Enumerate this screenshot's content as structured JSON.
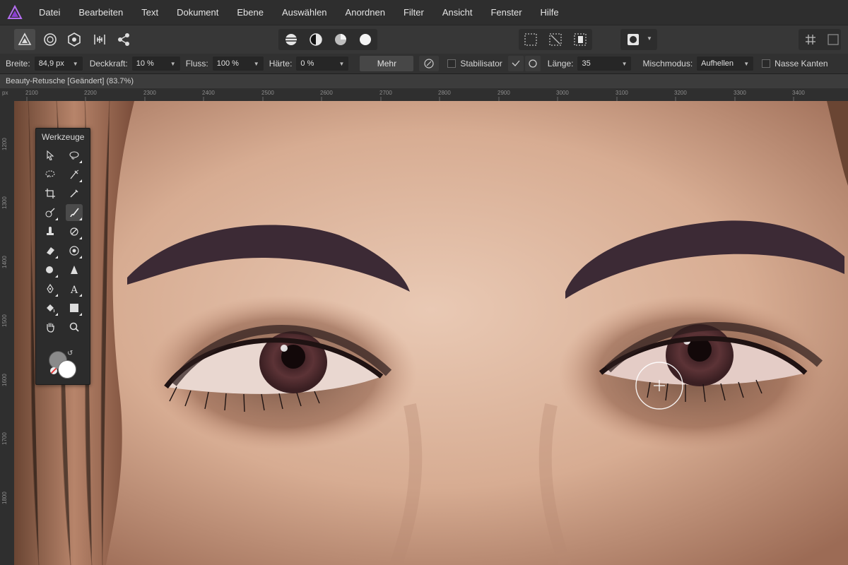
{
  "app": {
    "logo_icon": "affinity-photo-logo-icon",
    "accent": "#a25bd7"
  },
  "menu": [
    "Datei",
    "Bearbeiten",
    "Text",
    "Dokument",
    "Ebene",
    "Auswählen",
    "Anordnen",
    "Filter",
    "Ansicht",
    "Fenster",
    "Hilfe"
  ],
  "toolbar": {
    "personas": [
      "photo-persona-icon",
      "liquify-persona-icon",
      "develop-persona-icon",
      "tone-mapping-persona-icon",
      "export-persona-icon"
    ],
    "adjust": [
      "auto-levels-icon",
      "auto-contrast-icon",
      "auto-colors-icon",
      "auto-white-balance-icon"
    ],
    "selection": [
      "marquee-select-icon",
      "invert-select-icon",
      "selection-mask-icon"
    ],
    "quickmask": "quick-mask-icon",
    "arrange": "snapping-grid-icon"
  },
  "context": {
    "breite_label": "Breite:",
    "breite_value": "84,9 px",
    "deckkraft_label": "Deckkraft:",
    "deckkraft_value": "10 %",
    "fluss_label": "Fluss:",
    "fluss_value": "100 %",
    "haerte_label": "Härte:",
    "haerte_value": "0 %",
    "mehr_label": "Mehr",
    "stabilisator_label": "Stabilisator",
    "laenge_label": "Länge:",
    "laenge_value": "35",
    "mischmodus_label": "Mischmodus:",
    "mischmodus_value": "Aufhellen",
    "nasse_kanten_label": "Nasse Kanten"
  },
  "document": {
    "tab_title": "Beauty-Retusche [Geändert] (83.7%)"
  },
  "ruler": {
    "unit": "px",
    "top": [
      "2100",
      "2200",
      "2300",
      "2400",
      "2500",
      "2600",
      "2700",
      "2800",
      "2900",
      "3000",
      "3100",
      "3200",
      "3300",
      "3400"
    ],
    "left": [
      "1200",
      "1300",
      "1400",
      "1500",
      "1600",
      "1700",
      "1800"
    ]
  },
  "tools_panel": {
    "title": "Werkzeuge",
    "tools": [
      "move-tool-icon",
      "freehand-selection-icon",
      "selection-brush-icon",
      "flood-select-icon",
      "crop-tool-icon",
      "color-picker-icon",
      "inpainting-brush-icon",
      "paint-brush-icon",
      "clone-brush-icon",
      "dodge-brush-icon",
      "eraser-icon",
      "red-eye-icon",
      "blur-brush-icon",
      "sharpen-brush-icon",
      "pen-tool-icon",
      "text-tool-icon",
      "fill-tool-icon",
      "rectangle-tool-icon",
      "hand-tool-icon",
      "zoom-tool-icon"
    ],
    "active_tool": "paint-brush-icon",
    "primary_color": "#ffffff",
    "secondary_color": "#8a8a8a"
  }
}
